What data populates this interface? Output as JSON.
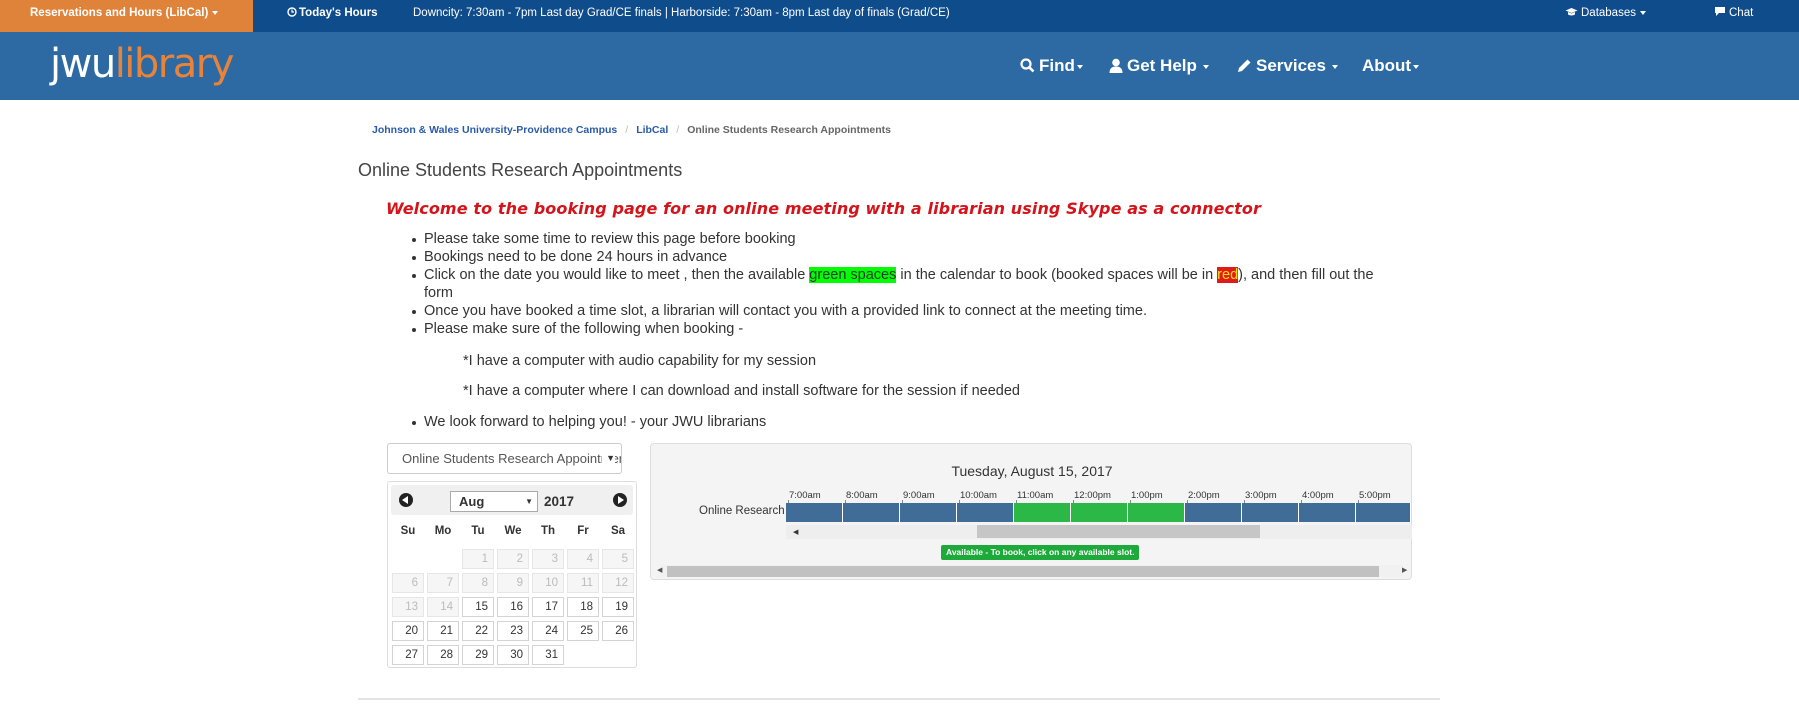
{
  "topbar": {
    "reservations": "Reservations and Hours (LibCal)",
    "today": "Today's Hours",
    "hours_text": "Downcity: 7:30am - 7pm Last day Grad/CE finals | Harborside: 7:30am - 8pm Last day of finals (Grad/CE)",
    "databases": "Databases",
    "chat": "Chat"
  },
  "header": {
    "logo_part1": "jwu",
    "logo_part2": "library",
    "nav": [
      {
        "label": "Find",
        "icon": "search-icon"
      },
      {
        "label": "Get Help",
        "icon": "user-icon"
      },
      {
        "label": "Services",
        "icon": "pencil-icon"
      },
      {
        "label": "About",
        "icon": ""
      }
    ]
  },
  "breadcrumb": [
    "Johnson & Wales University-Providence Campus",
    "LibCal",
    "Online Students Research Appointments"
  ],
  "page_title": "Online Students Research Appointments",
  "welcome": "Welcome to the booking page for an online meeting with a librarian using Skype as a connector",
  "instructions": {
    "item1": "Please take some time to review this page before booking",
    "item2": "Bookings need to be done 24 hours in advance",
    "item3_a": "Click on the date you would like to meet , then the available ",
    "item3_green": "green spaces",
    "item3_b": " in the calendar to book (booked spaces will be in ",
    "item3_red": "red",
    "item3_c": "), and then fill out the form",
    "item4": "Once you have booked a time slot, a librarian will contact you with a provided link to connect at the meeting time.",
    "item5": "Please make sure of the following when booking -",
    "sub1": "*I have a computer with audio capability for my session",
    "sub2": "*I have a computer where I can download and install software for the session if needed",
    "item6": "We look forward to helping you! - your JWU librarians"
  },
  "category_select": {
    "value": "Online Students Research Appointments"
  },
  "datepicker": {
    "month": "Aug",
    "year": "2017",
    "weekdays": [
      "Su",
      "Mo",
      "Tu",
      "We",
      "Th",
      "Fr",
      "Sa"
    ],
    "weeks": [
      [
        null,
        null,
        {
          "d": "1",
          "on": false
        },
        {
          "d": "2",
          "on": false
        },
        {
          "d": "3",
          "on": false
        },
        {
          "d": "4",
          "on": false
        },
        {
          "d": "5",
          "on": false
        }
      ],
      [
        {
          "d": "6",
          "on": false
        },
        {
          "d": "7",
          "on": false
        },
        {
          "d": "8",
          "on": false
        },
        {
          "d": "9",
          "on": false
        },
        {
          "d": "10",
          "on": false
        },
        {
          "d": "11",
          "on": false
        },
        {
          "d": "12",
          "on": false
        }
      ],
      [
        {
          "d": "13",
          "on": false
        },
        {
          "d": "14",
          "on": false
        },
        {
          "d": "15",
          "on": true
        },
        {
          "d": "16",
          "on": true
        },
        {
          "d": "17",
          "on": true
        },
        {
          "d": "18",
          "on": true
        },
        {
          "d": "19",
          "on": true
        }
      ],
      [
        {
          "d": "20",
          "on": true
        },
        {
          "d": "21",
          "on": true
        },
        {
          "d": "22",
          "on": true
        },
        {
          "d": "23",
          "on": true
        },
        {
          "d": "24",
          "on": true
        },
        {
          "d": "25",
          "on": true
        },
        {
          "d": "26",
          "on": true
        }
      ],
      [
        {
          "d": "27",
          "on": true
        },
        {
          "d": "28",
          "on": true
        },
        {
          "d": "29",
          "on": true
        },
        {
          "d": "30",
          "on": true
        },
        {
          "d": "31",
          "on": true
        },
        null,
        null
      ]
    ]
  },
  "schedule": {
    "date": "Tuesday, August 15, 2017",
    "row_label": "Online Research",
    "times": [
      "7:00am",
      "8:00am",
      "9:00am",
      "10:00am",
      "11:00am",
      "12:00pm",
      "1:00pm",
      "2:00pm",
      "3:00pm",
      "4:00pm",
      "5:00pm"
    ],
    "slots": [
      "booked",
      "booked",
      "booked",
      "booked",
      "available",
      "available",
      "available",
      "booked",
      "booked",
      "booked",
      "booked"
    ],
    "legend": "Available - To book, click on any available slot."
  },
  "colors": {
    "booked": "#3f6d98",
    "available": "#2bb847",
    "header_bg": "#2d6aa4",
    "topbar_bg": "#0f4c8c",
    "accent": "#e0833a"
  }
}
